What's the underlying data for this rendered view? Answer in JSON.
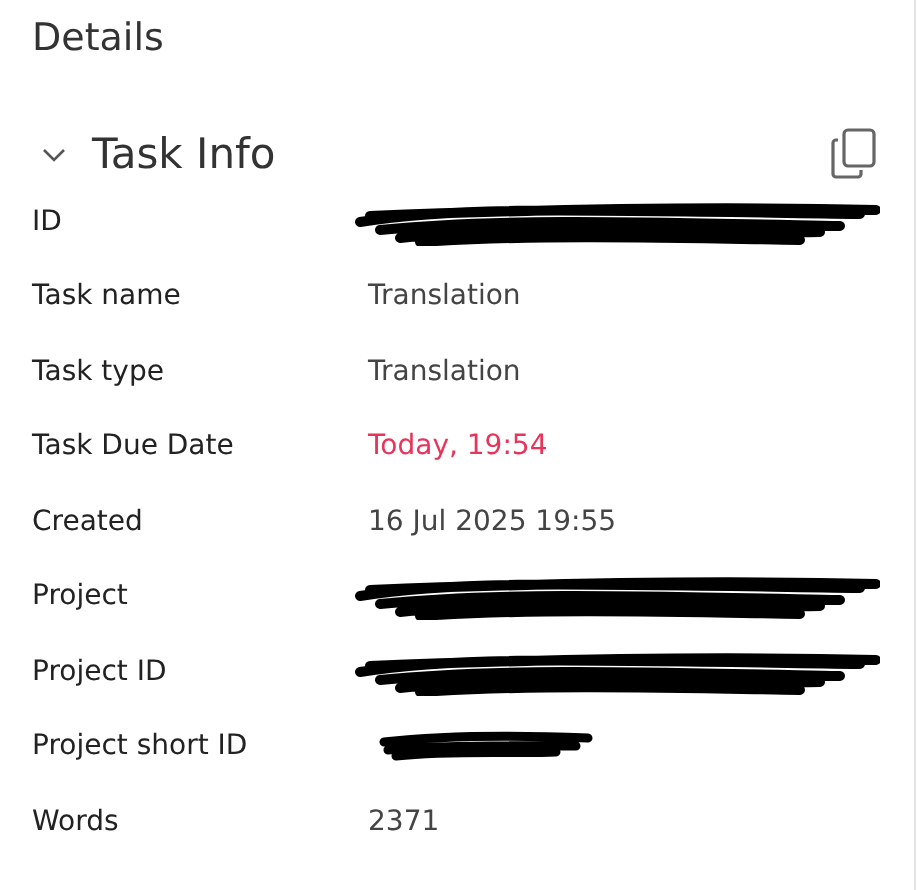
{
  "title": "Details",
  "section": {
    "title": "Task Info",
    "expanded": true
  },
  "rows": [
    {
      "label": "ID",
      "kind": "redacted"
    },
    {
      "label": "Task name",
      "kind": "text",
      "value": "Translation"
    },
    {
      "label": "Task type",
      "kind": "text",
      "value": "Translation"
    },
    {
      "label": "Task Due Date",
      "kind": "overdue",
      "value": "Today, 19:54"
    },
    {
      "label": "Created",
      "kind": "text",
      "value": "16 Jul 2025 19:55"
    },
    {
      "label": "Project",
      "kind": "redacted"
    },
    {
      "label": "Project ID",
      "kind": "redacted"
    },
    {
      "label": "Project short ID",
      "kind": "redacted_short"
    },
    {
      "label": "Words",
      "kind": "text",
      "value": "2371"
    }
  ]
}
